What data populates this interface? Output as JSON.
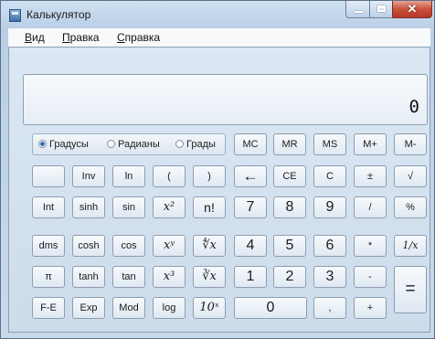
{
  "window": {
    "title": "Калькулятор"
  },
  "menu": [
    {
      "label": "Вид",
      "accel": "В"
    },
    {
      "label": "Правка",
      "accel": "П"
    },
    {
      "label": "Справка",
      "accel": "С"
    }
  ],
  "display": {
    "value": "0"
  },
  "angle_mode": {
    "options": [
      "Градусы",
      "Радианы",
      "Грады"
    ],
    "selected": "Градусы"
  },
  "keys": {
    "mc": "MC",
    "mr": "MR",
    "ms": "MS",
    "mplus": "M+",
    "mminus": "M-",
    "blank": "",
    "inv": "Inv",
    "ln": "ln",
    "lparen": "(",
    "rparen": ")",
    "backspace": "←",
    "ce": "CE",
    "c": "C",
    "plusminus": "±",
    "sqrt": "√",
    "int": "Int",
    "sinh": "sinh",
    "sin": "sin",
    "x2": "x²",
    "nfact": "n!",
    "n7": "7",
    "n8": "8",
    "n9": "9",
    "divide": "/",
    "percent": "%",
    "dms": "dms",
    "cosh": "cosh",
    "cos": "cos",
    "xy": "xʸ",
    "yroot": "∜x",
    "n4": "4",
    "n5": "5",
    "n6": "6",
    "multiply": "*",
    "reciprocal": "1/x",
    "pi": "π",
    "tanh": "tanh",
    "tan": "tan",
    "x3": "x³",
    "cuberoot": "∛x",
    "n1": "1",
    "n2": "2",
    "n3": "3",
    "minus": "-",
    "equals": "=",
    "fe": "F-E",
    "exp": "Exp",
    "mod": "Mod",
    "log": "log",
    "tenx": "10ˣ",
    "n0": "0",
    "comma": ",",
    "plus": "+"
  }
}
